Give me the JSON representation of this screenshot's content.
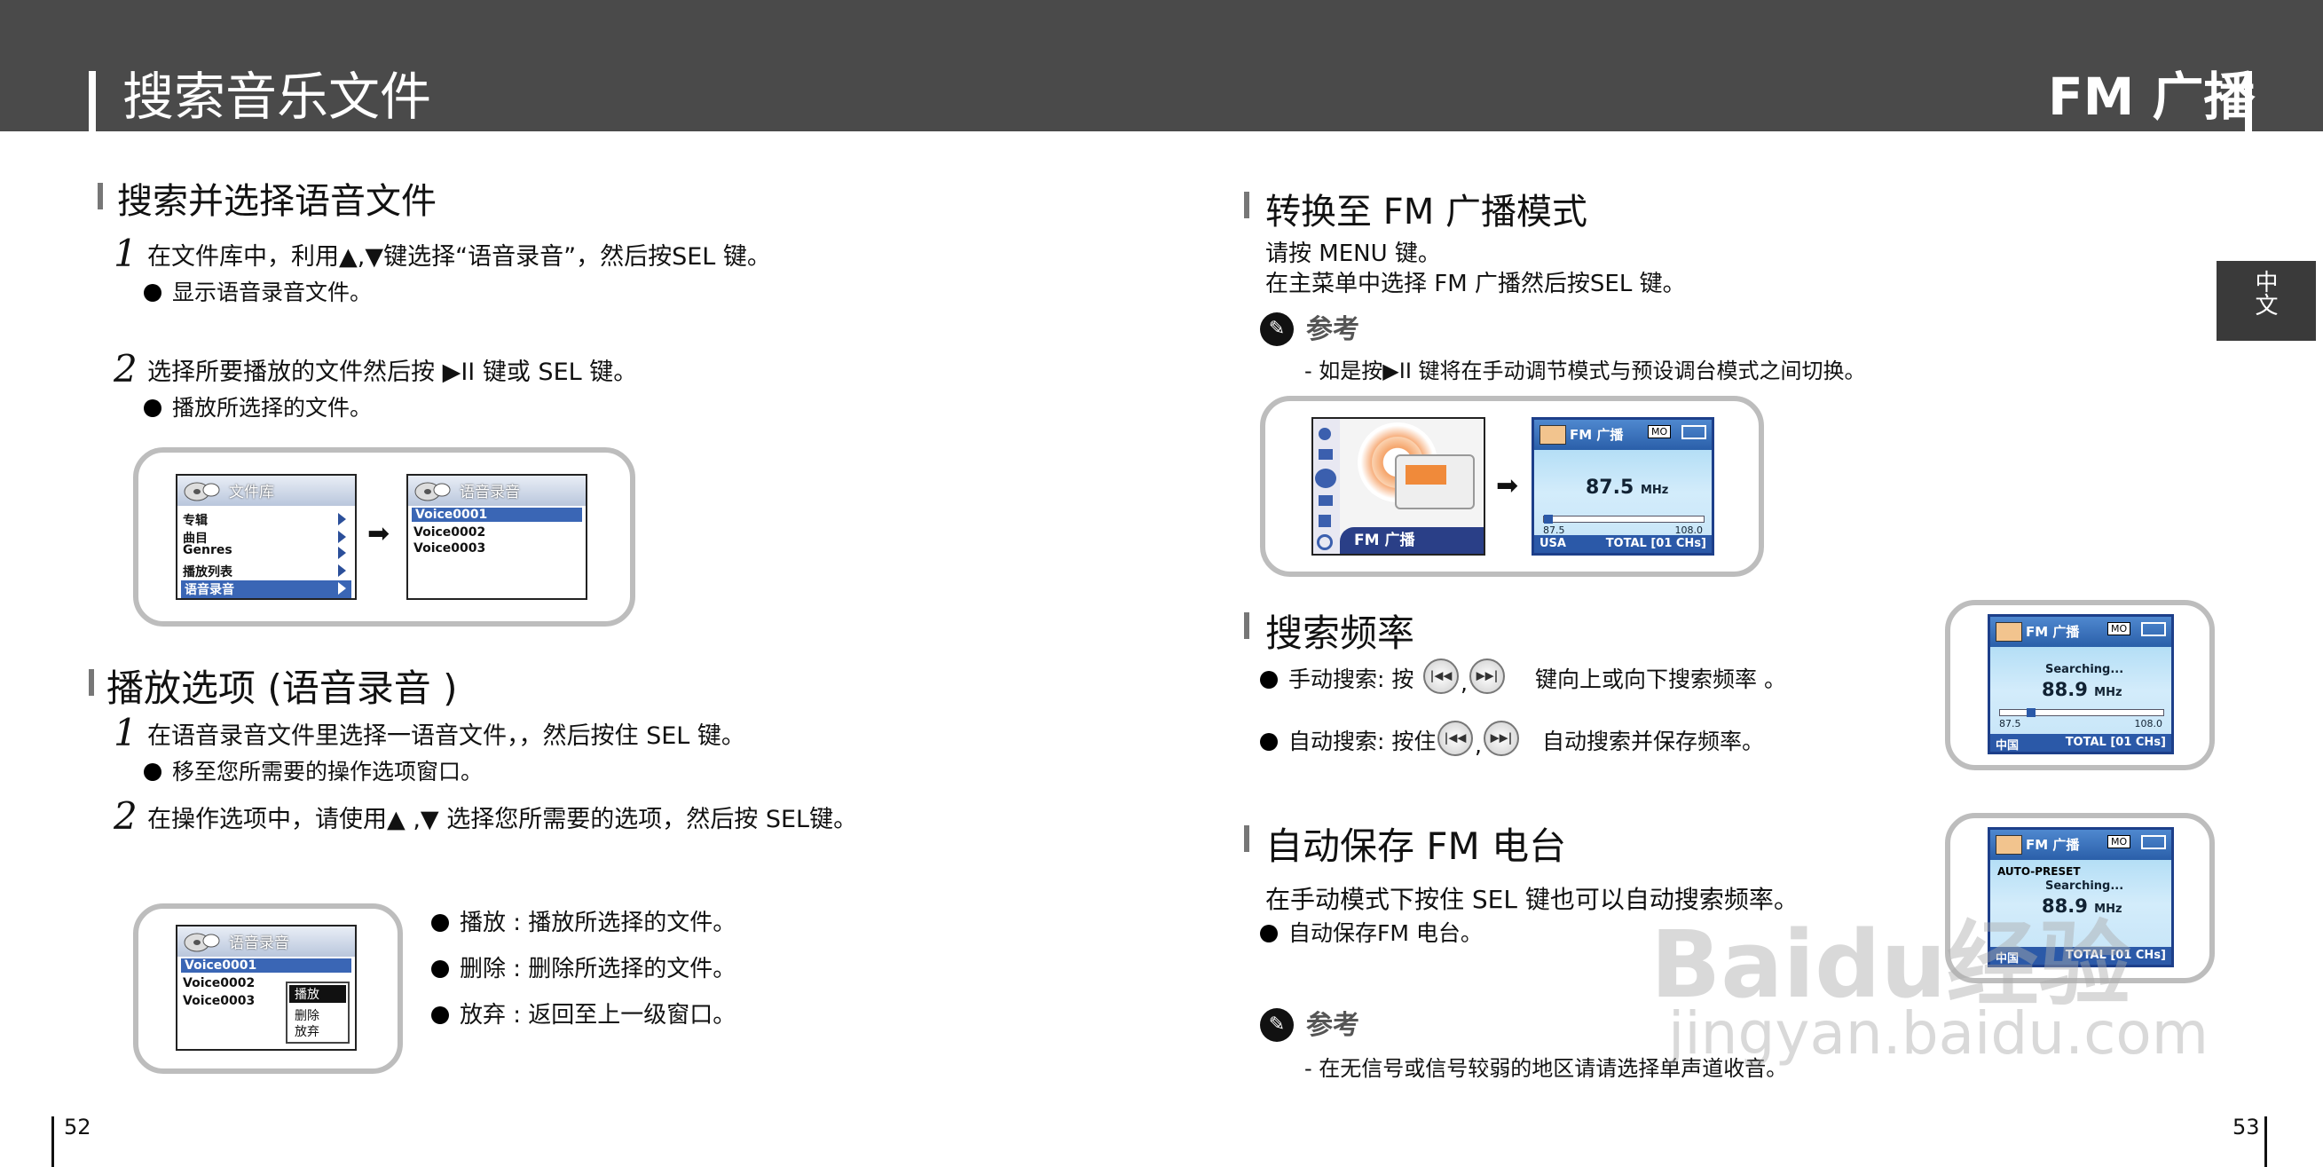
{
  "header": {
    "left_title": "搜索音乐文件",
    "right_title": "FM 广播"
  },
  "side_tab": "中文",
  "left": {
    "section1": {
      "title": "搜索并选择语音文件",
      "step1_num": "1",
      "step1_text": "在文件库中，利用▲,▼键选择“语音录音”，然后按SEL 键。",
      "step1_bullet": "显示语音录音文件。",
      "step2_num": "2",
      "step2_text": "选择所要播放的文件然后按 ▶II 键或 SEL 键。",
      "step2_bullet": "播放所选择的文件。",
      "screen_a": {
        "header": "文件库",
        "items": [
          "专辑",
          "曲目",
          "Genres",
          "播放列表",
          "语音录音"
        ]
      },
      "screen_b": {
        "header": "语音录音",
        "items": [
          "Voice0001",
          "Voice0002",
          "Voice0003"
        ]
      }
    },
    "section2": {
      "title": "播放选项 (语音录音 )",
      "step1_num": "1",
      "step1_text": "在语音录音文件里选择一语音文件，，然后按住 SEL 键。",
      "step1_bullet": "移至您所需要的操作选项窗口。",
      "step2_num": "2",
      "step2_text": "在操作选项中，请使用▲ ,▼ 选择您所需要的选项，然后按 SEL键。",
      "screen_c": {
        "header": "语音录音",
        "items": [
          "Voice0001",
          "Voice0002",
          "Voice0003"
        ],
        "menu": [
          "播放",
          "删除",
          "放弃"
        ]
      },
      "bullets": [
        "播放 : 播放所选择的文件。",
        "删除 : 删除所选择的文件。",
        "放弃 : 返回至上一级窗口。"
      ]
    },
    "page_number": "52"
  },
  "right": {
    "section1": {
      "title": "转换至 FM  广播模式",
      "line1": "请按 MENU 键。",
      "line2": "在主菜单中选择 FM  广播然后按SEL 键。",
      "note_label": "参考",
      "note_text": "-  如是按▶II 键将在手动调节模式与预设调台模式之间切换。",
      "menu_label": "FM  广播",
      "fm_screen": {
        "title": "FM  广播",
        "badge": "MO",
        "freq": "87.5",
        "unit": "MHz",
        "min": "87.5",
        "max": "108.0",
        "region": "USA",
        "total": "TOTAL [01 CHs]"
      }
    },
    "section2": {
      "title": "搜索频率",
      "bullet1_a": "手动搜索: 按",
      "bullet1_b": "键向上或向下搜索频率 。",
      "bullet2_a": "自动搜索: 按住",
      "bullet2_b": "自动搜索并保存频率。",
      "sep": ",",
      "fm_screen": {
        "title": "FM  广播",
        "badge": "MO",
        "status": "Searching...",
        "freq": "88.9",
        "unit": "MHz",
        "min": "87.5",
        "max": "108.0",
        "region": "中国",
        "total": "TOTAL [01 CHs]"
      }
    },
    "section3": {
      "title": "自动保存 FM 电台",
      "line1": "在手动模式下按住 SEL 键也可以自动搜索频率。",
      "bullet": "自动保存FM  电台。",
      "fm_screen": {
        "title": "FM  广播",
        "badge": "MO",
        "preset": "AUTO-PRESET",
        "status": "Searching...",
        "freq": "88.9",
        "unit": "MHz",
        "region": "中国",
        "total": "TOTAL [01 CHs]"
      },
      "note_label": "参考",
      "note_text": "-  在无信号或信号较弱的地区请请选择单声道收音。"
    },
    "page_number": "53"
  },
  "watermark": {
    "brand": "Baidu经验",
    "url": "jingyan.baidu.com"
  }
}
